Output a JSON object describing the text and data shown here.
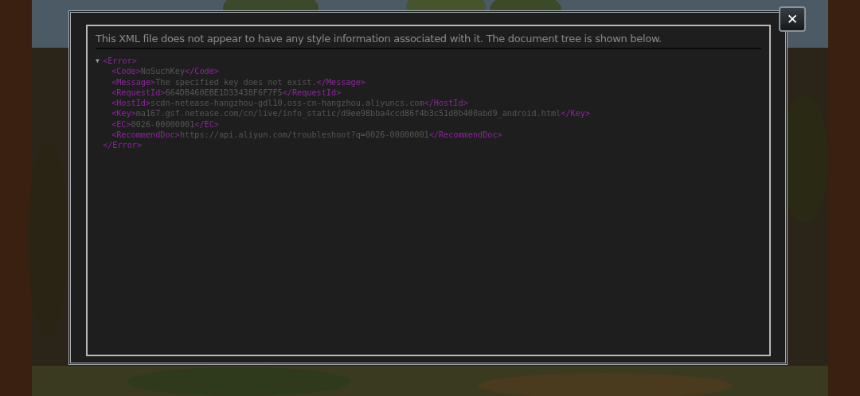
{
  "close_button": {
    "label": "✕"
  },
  "banner": "This XML file does not appear to have any style information associated with it. The document tree is shown below.",
  "tree": {
    "toggle": "▼",
    "expanded": true,
    "open": "<Error>",
    "close": "</Error>",
    "children": [
      {
        "open": "<Code>",
        "value": "NoSuchKey",
        "close": "</Code>"
      },
      {
        "open": "<Message>",
        "value": "The specified key does not exist.",
        "close": "</Message>"
      },
      {
        "open": "<RequestId>",
        "value": "664DB460EBE1D33438F6F7F5",
        "close": "</RequestId>"
      },
      {
        "open": "<HostId>",
        "value": "scdn-netease-hangzhou-gdl10.oss-cn-hangzhou.aliyuncs.com",
        "close": "</HostId>"
      },
      {
        "open": "<Key>",
        "value": "ma167.gsf.netease.com/cn/live/info_static/d9ee98bba4ccd86f4b3c51d0b400abd9_android.html",
        "close": "</Key>"
      },
      {
        "open": "<EC>",
        "value": "0026-00000001",
        "close": "</EC>"
      },
      {
        "open": "<RecommendDoc>",
        "value": "https://api.aliyun.com/troubleshoot?q=0026-00000001",
        "close": "</RecommendDoc>"
      }
    ]
  }
}
